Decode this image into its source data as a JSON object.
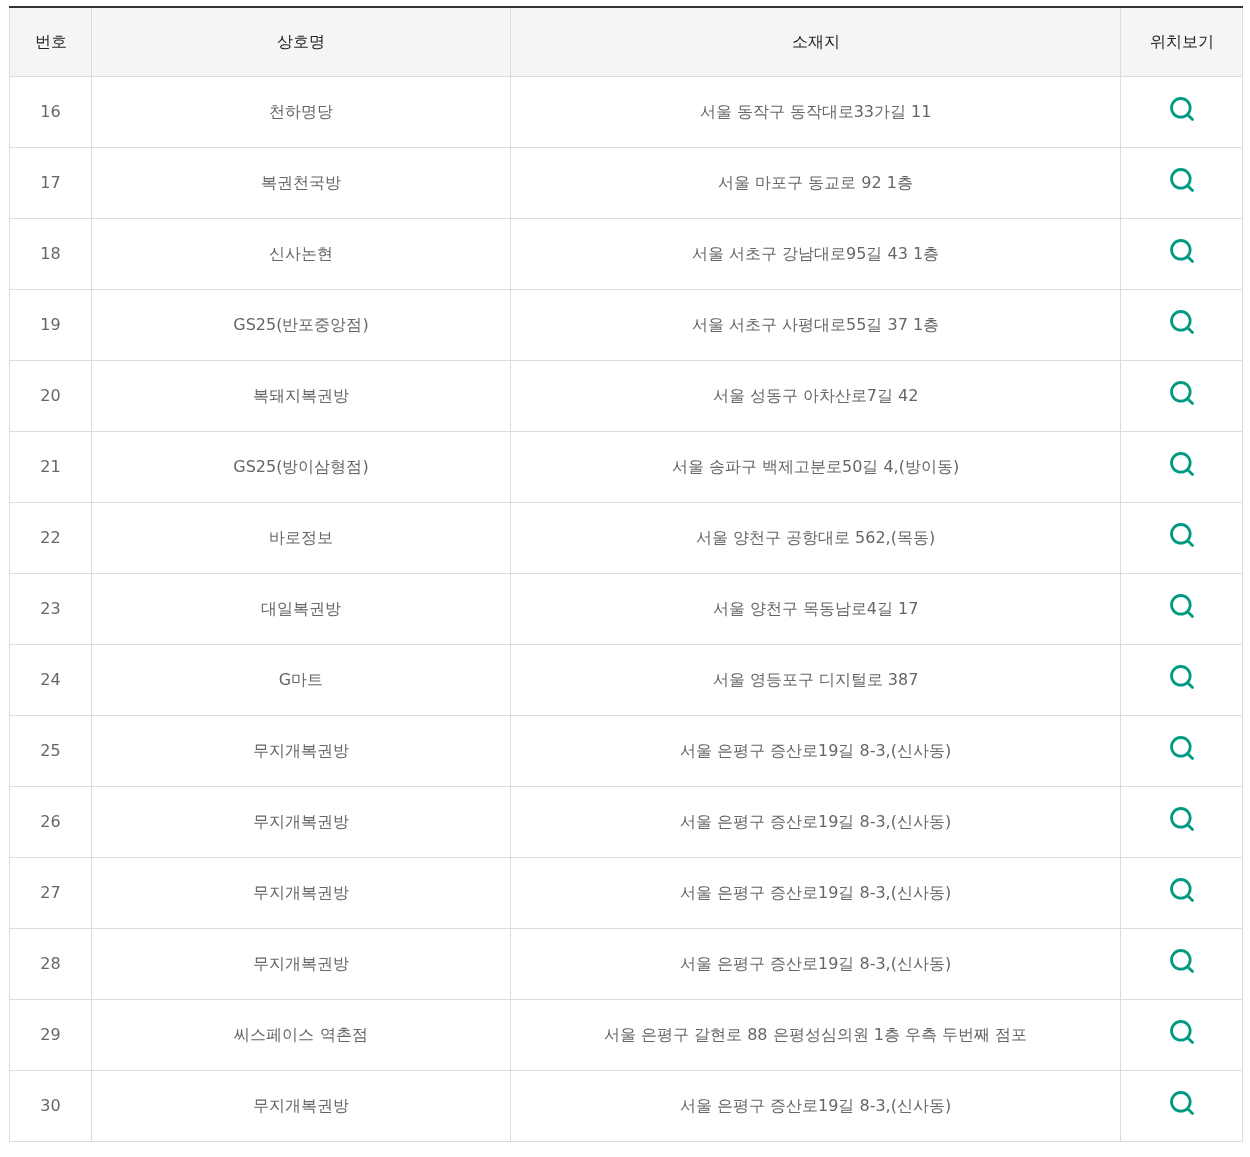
{
  "table": {
    "columns": [
      "번호",
      "상호명",
      "소재지",
      "위치보기"
    ],
    "rows": [
      {
        "number": "16",
        "name": "천하명당",
        "address": "서울 동작구 동작대로33가길 11"
      },
      {
        "number": "17",
        "name": "복권천국방",
        "address": "서울 마포구 동교로 92 1층"
      },
      {
        "number": "18",
        "name": "신사논현",
        "address": "서울 서초구 강남대로95길 43 1층"
      },
      {
        "number": "19",
        "name": "GS25(반포중앙점)",
        "address": "서울 서초구 사평대로55길 37 1층"
      },
      {
        "number": "20",
        "name": "복돼지복권방",
        "address": "서울 성동구 아차산로7길 42"
      },
      {
        "number": "21",
        "name": "GS25(방이삼형점)",
        "address": "서울 송파구 백제고분로50길 4,(방이동)"
      },
      {
        "number": "22",
        "name": "바로정보",
        "address": "서울 양천구 공항대로 562,(목동)"
      },
      {
        "number": "23",
        "name": "대일복권방",
        "address": "서울 양천구 목동남로4길 17"
      },
      {
        "number": "24",
        "name": "G마트",
        "address": "서울 영등포구 디지털로 387"
      },
      {
        "number": "25",
        "name": "무지개복권방",
        "address": "서울 은평구 증산로19길 8-3,(신사동)"
      },
      {
        "number": "26",
        "name": "무지개복권방",
        "address": "서울 은평구 증산로19길 8-3,(신사동)"
      },
      {
        "number": "27",
        "name": "무지개복권방",
        "address": "서울 은평구 증산로19길 8-3,(신사동)"
      },
      {
        "number": "28",
        "name": "무지개복권방",
        "address": "서울 은평구 증산로19길 8-3,(신사동)"
      },
      {
        "number": "29",
        "name": "씨스페이스 역촌점",
        "address": "서울 은평구 갈현로 88 은평성심의원 1층 우측 두번째 점포"
      },
      {
        "number": "30",
        "name": "무지개복권방",
        "address": "서울 은평구 증산로19길 8-3,(신사동)"
      }
    ]
  }
}
